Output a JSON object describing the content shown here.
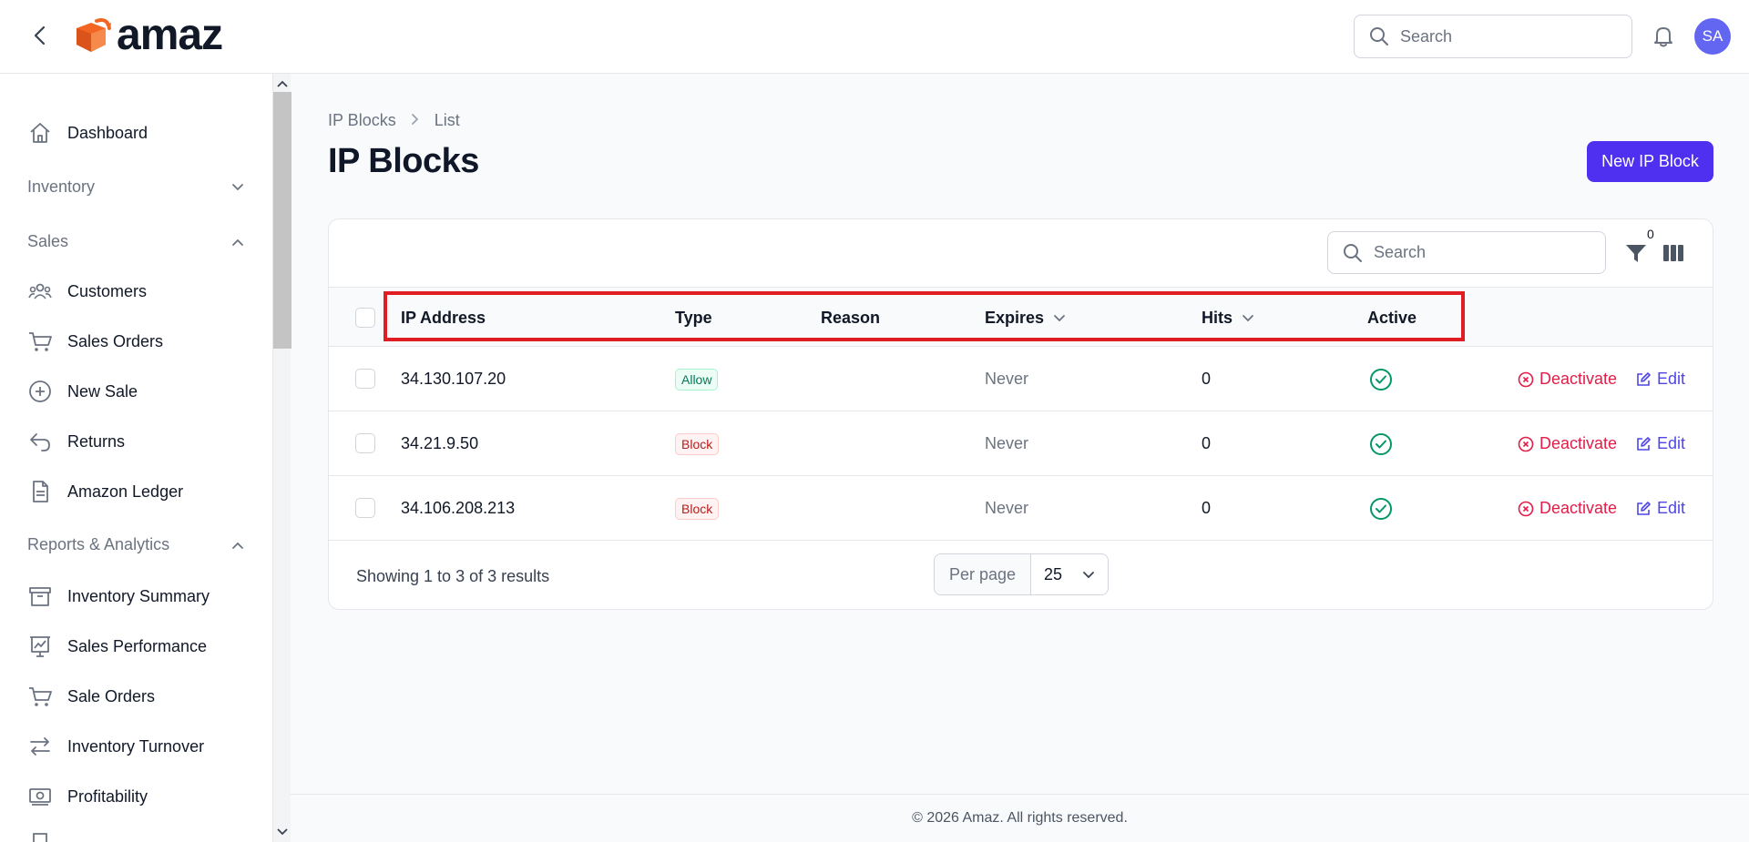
{
  "topbar": {
    "logo_text": "amaz",
    "search_placeholder": "Search",
    "avatar_initials": "SA",
    "brand_color": "#f26522"
  },
  "sidebar": {
    "dashboard": "Dashboard",
    "inventory_group": "Inventory",
    "sales_group": "Sales",
    "customers": "Customers",
    "sales_orders": "Sales Orders",
    "new_sale": "New Sale",
    "returns": "Returns",
    "amazon_ledger": "Amazon Ledger",
    "reports_group": "Reports & Analytics",
    "inventory_summary": "Inventory Summary",
    "sales_performance": "Sales Performance",
    "sale_orders": "Sale Orders",
    "inventory_turnover": "Inventory Turnover",
    "profitability": "Profitability"
  },
  "breadcrumb": {
    "root": "IP Blocks",
    "current": "List"
  },
  "page": {
    "title": "IP Blocks",
    "new_button": "New IP Block",
    "accent": "#4f2ff0"
  },
  "table": {
    "search_placeholder": "Search",
    "filter_count": "0",
    "columns": {
      "ip": "IP Address",
      "type": "Type",
      "reason": "Reason",
      "expires": "Expires",
      "hits": "Hits",
      "active": "Active"
    },
    "rows": [
      {
        "ip": "34.130.107.20",
        "type": "Allow",
        "reason": "",
        "expires": "Never",
        "hits": "0",
        "active": true,
        "deactivate": "Deactivate",
        "edit": "Edit"
      },
      {
        "ip": "34.21.9.50",
        "type": "Block",
        "reason": "",
        "expires": "Never",
        "hits": "0",
        "active": true,
        "deactivate": "Deactivate",
        "edit": "Edit"
      },
      {
        "ip": "34.106.208.213",
        "type": "Block",
        "reason": "",
        "expires": "Never",
        "hits": "0",
        "active": true,
        "deactivate": "Deactivate",
        "edit": "Edit"
      }
    ],
    "footer": {
      "summary": "Showing 1 to 3 of 3 results",
      "per_page_label": "Per page",
      "per_page_value": "25"
    }
  },
  "footer": {
    "copyright": "© 2026 Amaz. All rights reserved."
  }
}
